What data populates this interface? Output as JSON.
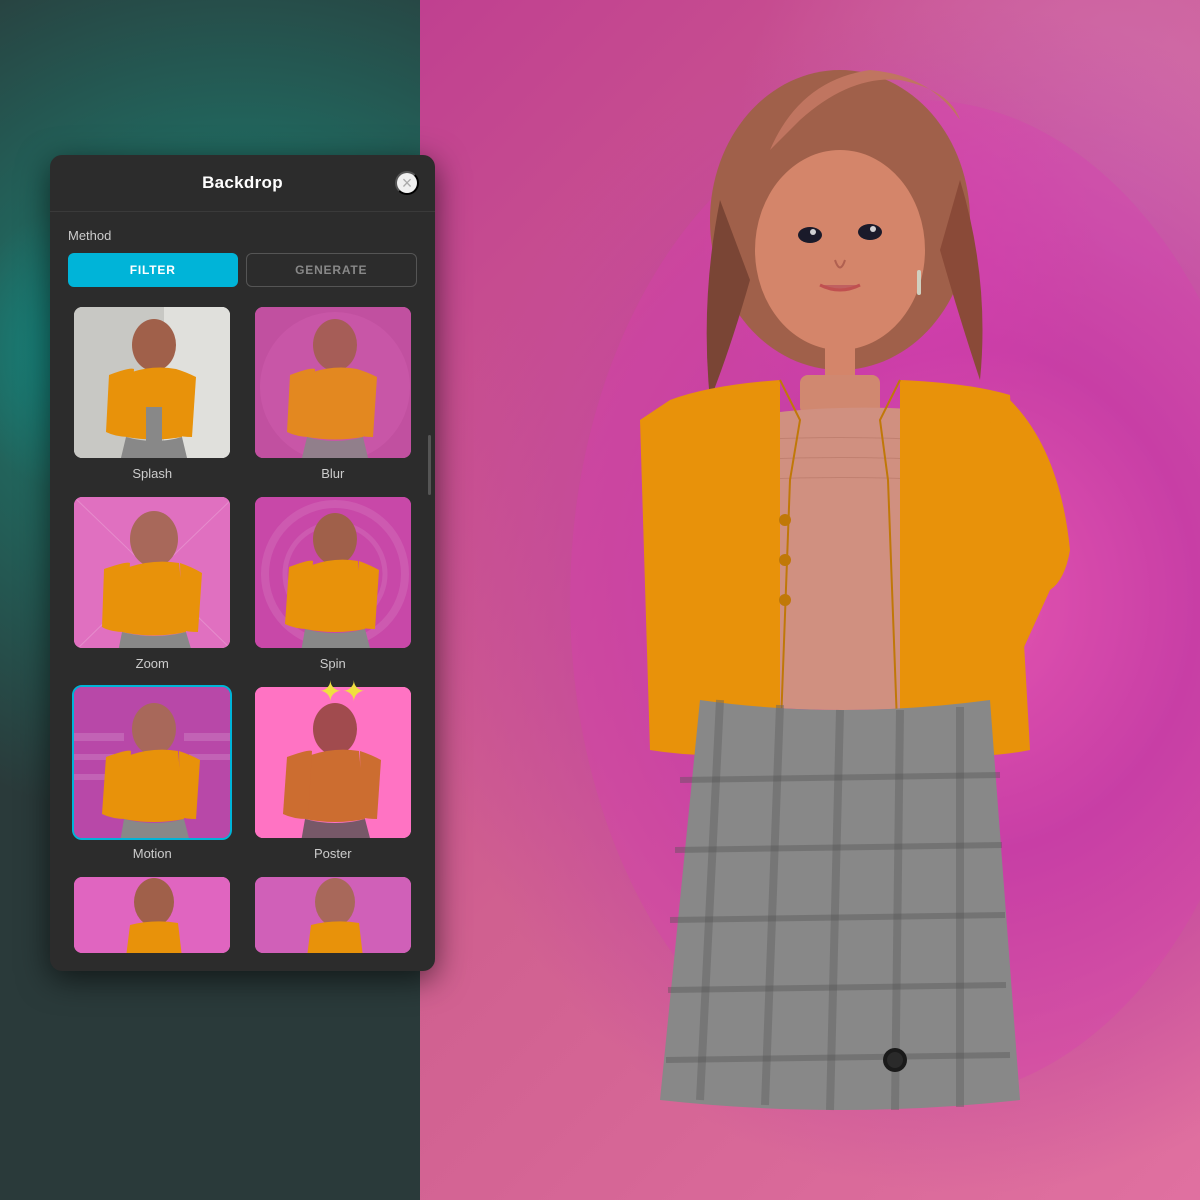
{
  "background": {
    "gradient": "teal-pink"
  },
  "panel": {
    "title": "Backdrop",
    "close_label": "×",
    "method": {
      "label": "Method",
      "buttons": [
        {
          "id": "filter",
          "label": "FILTER",
          "active": true
        },
        {
          "id": "generate",
          "label": "GENERATE",
          "active": false
        }
      ]
    },
    "filters": [
      {
        "id": "splash",
        "name": "Splash",
        "selected": false,
        "has_sparkle": false,
        "thumb_class": "thumb-splash"
      },
      {
        "id": "blur",
        "name": "Blur",
        "selected": false,
        "has_sparkle": false,
        "thumb_class": "thumb-blur"
      },
      {
        "id": "zoom",
        "name": "Zoom",
        "selected": false,
        "has_sparkle": false,
        "thumb_class": "thumb-zoom"
      },
      {
        "id": "spin",
        "name": "Spin",
        "selected": false,
        "has_sparkle": false,
        "thumb_class": "thumb-spin"
      },
      {
        "id": "motion",
        "name": "Motion",
        "selected": true,
        "has_sparkle": false,
        "thumb_class": "thumb-motion"
      },
      {
        "id": "poster",
        "name": "Poster",
        "selected": false,
        "has_sparkle": true,
        "thumb_class": "thumb-poster"
      },
      {
        "id": "extra1",
        "name": "",
        "selected": false,
        "has_sparkle": false,
        "thumb_class": "thumb-extra1"
      },
      {
        "id": "extra2",
        "name": "",
        "selected": false,
        "has_sparkle": false,
        "thumb_class": "thumb-extra2"
      }
    ]
  }
}
